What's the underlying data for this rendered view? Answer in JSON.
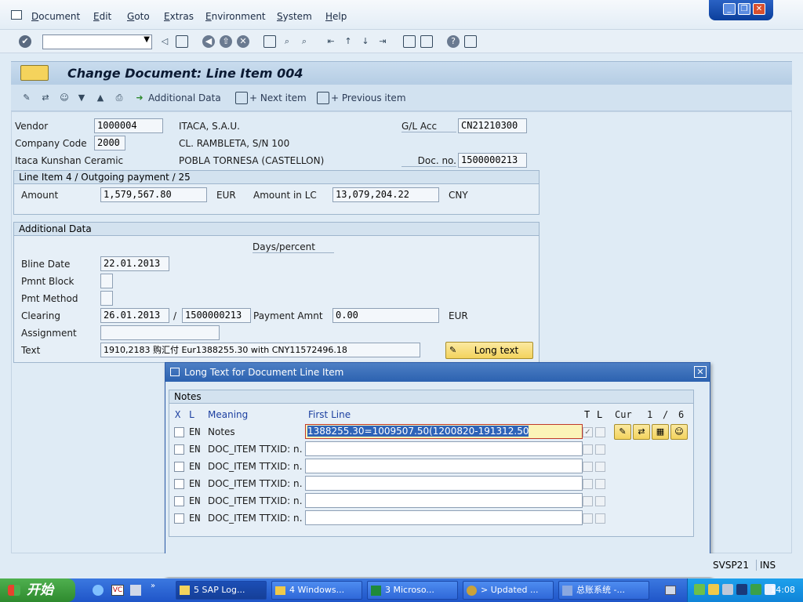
{
  "menu": {
    "items": [
      "Document",
      "Edit",
      "Goto",
      "Extras",
      "Environment",
      "System",
      "Help"
    ]
  },
  "window_controls": {
    "minimize": "_",
    "restore": "❐",
    "close": "✕"
  },
  "title": "Change Document: Line Item 004",
  "app_toolbar": {
    "additional_data": "Additional Data",
    "next_item": "+ Next item",
    "previous_item": "+ Previous item"
  },
  "header": {
    "vendor_label": "Vendor",
    "vendor": "1000004",
    "vendor_name": "ITACA, S.A.U.",
    "company_code_label": "Company Code",
    "company_code": "2000",
    "street": "CL. RAMBLETA, S/N 100",
    "company_name": "Itaca Kunshan Ceramic",
    "city": "POBLA TORNESA (CASTELLON)",
    "gl_acc_label": "G/L Acc",
    "gl_acc": "CN21210300",
    "doc_no_label": "Doc. no.",
    "doc_no": "1500000213"
  },
  "line_item": {
    "title": "Line Item 4 / Outgoing payment / 25",
    "amount_label": "Amount",
    "amount": "1,579,567.80",
    "currency": "EUR",
    "amount_lc_label": "Amount in LC",
    "amount_lc": "13,079,204.22",
    "currency_lc": "CNY"
  },
  "additional_data": {
    "title": "Additional Data",
    "days_percent": "Days/percent",
    "bline_date_label": "Bline Date",
    "bline_date": "22.01.2013",
    "pmnt_block_label": "Pmnt Block",
    "pmt_method_label": "Pmt Method",
    "clearing_label": "Clearing",
    "clearing_date": "26.01.2013",
    "clearing_sep": "/",
    "clearing_doc": "1500000213",
    "payment_amnt_label": "Payment Amnt",
    "payment_amnt": "0.00",
    "payment_currency": "EUR",
    "assignment_label": "Assignment",
    "text_label": "Text",
    "text": "1910,2183 购汇付 Eur1388255.30 with CNY11572496.18",
    "long_text_button": "Long text"
  },
  "dialog": {
    "title": "Long Text for Document Line Item",
    "group_title": "Notes",
    "col_x": "X",
    "col_l": "L",
    "col_meaning": "Meaning",
    "col_first_line": "First Line",
    "col_t": "T",
    "col_l2": "L",
    "cur_label": "Cur",
    "cur_page": "1",
    "cur_sep": "/",
    "cur_total": "6",
    "rows": [
      {
        "lang": "EN",
        "meaning": "Notes",
        "first_line": "1388255.30=1009507.50(1200820-191312.50"
      },
      {
        "lang": "EN",
        "meaning": "DOC_ITEM TTXID: n…",
        "first_line": ""
      },
      {
        "lang": "EN",
        "meaning": "DOC_ITEM TTXID: n…",
        "first_line": ""
      },
      {
        "lang": "EN",
        "meaning": "DOC_ITEM TTXID: n…",
        "first_line": ""
      },
      {
        "lang": "EN",
        "meaning": "DOC_ITEM TTXID: n…",
        "first_line": ""
      },
      {
        "lang": "EN",
        "meaning": "DOC_ITEM TTXID: n…",
        "first_line": ""
      }
    ]
  },
  "status": {
    "system": "SVSP21",
    "mode": "INS"
  },
  "taskbar": {
    "start": "开始",
    "tasks": [
      "5 SAP Log...",
      "4 Windows...",
      "3 Microso...",
      "> Updated ...",
      "总账系统 -..."
    ],
    "clock": "14:08"
  },
  "colors": {
    "background": "#dfebf5",
    "title_bar": "#c9dcee",
    "dialog_title": "#2c62b0",
    "button_yellow": "#f3d35d",
    "taskbar": "#1f55c8",
    "start_green": "#2e8a2e"
  }
}
